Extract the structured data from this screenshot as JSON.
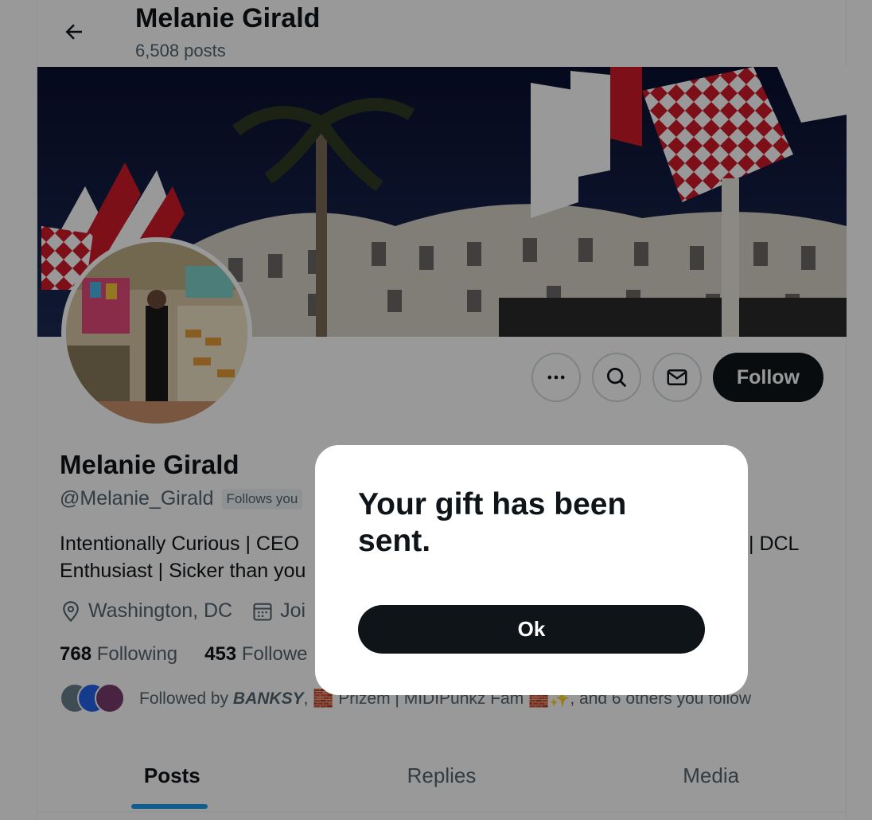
{
  "header": {
    "title": "Melanie Girald",
    "post_count": "6,508 posts"
  },
  "actions": {
    "follow_label": "Follow"
  },
  "profile": {
    "name": "Melanie Girald",
    "handle": "@Melanie_Girald",
    "follows_you": "Follows you",
    "bio_line1": "Intentionally Curious | CEO",
    "bio_line1_end": "| DCL",
    "bio_line2": "Enthusiast | Sicker than you",
    "location": "Washington, DC",
    "joined_partial": "Joi",
    "following_count": "768",
    "following_label": "Following",
    "followers_count": "453",
    "followers_label": "Followe",
    "followed_by_prefix": "Followed by",
    "followed_by_name": "BANKSY",
    "followed_by_rest": ", 🧱 Prizem | MIDIPunkz Fam 🧱✨, and 6 others you follow"
  },
  "tabs": [
    {
      "label": "Posts"
    },
    {
      "label": "Replies"
    },
    {
      "label": "Media"
    }
  ],
  "modal": {
    "message": "Your gift has been sent.",
    "ok_label": "Ok"
  },
  "colors": {
    "accent": "#1d9bf0",
    "dark": "#0f1419",
    "muted": "#536471",
    "overlay": "rgba(0,0,0,0.4)"
  }
}
